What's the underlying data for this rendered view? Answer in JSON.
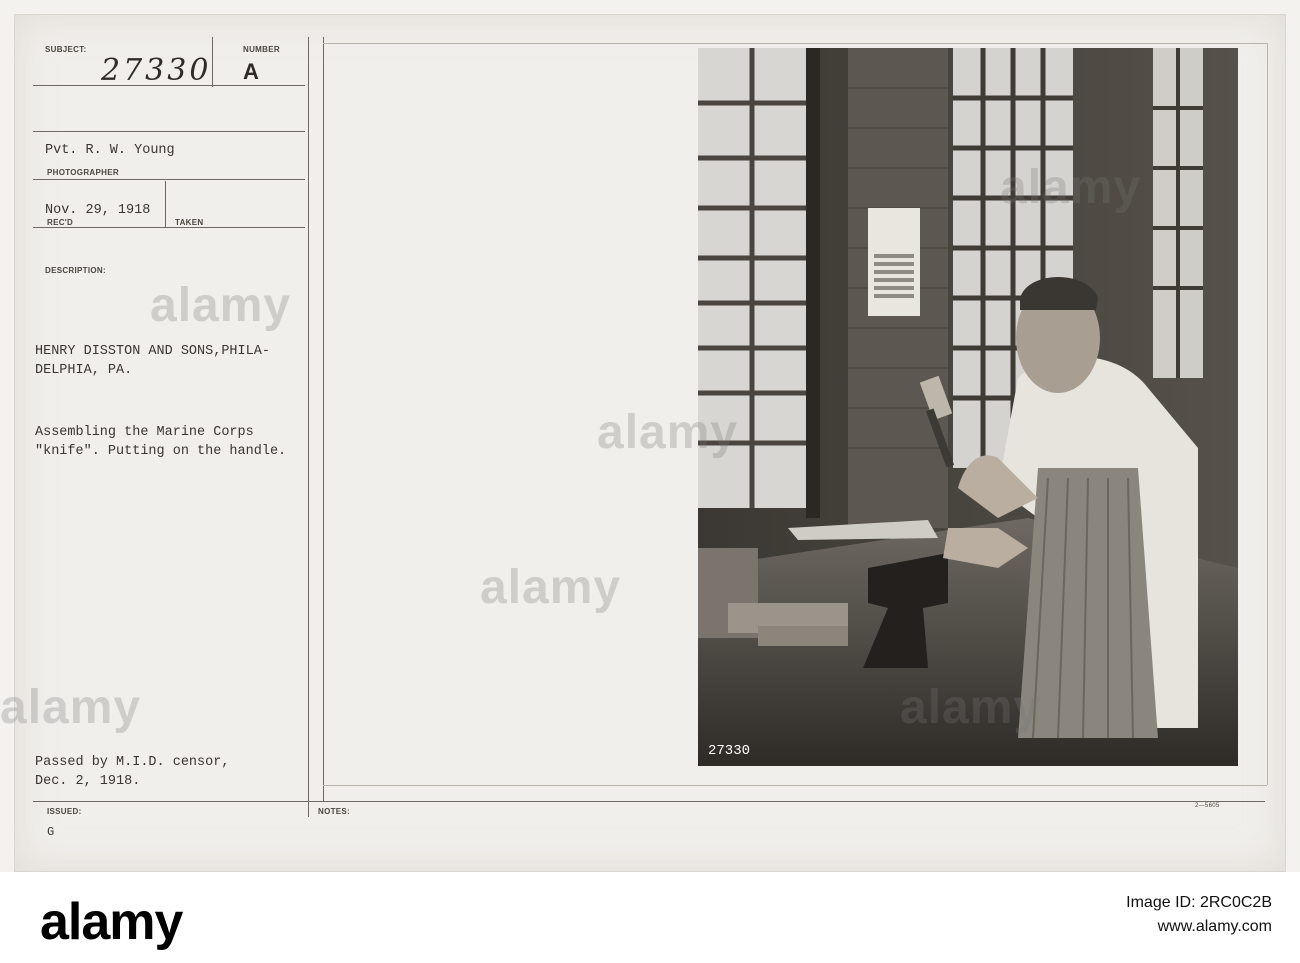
{
  "card": {
    "subject_label": "SUBJECT:",
    "number_label": "NUMBER",
    "subject_value": "27330",
    "number_value": "A",
    "photographer_value": "Pvt. R. W. Young",
    "photographer_label": "PHOTOGRAPHER",
    "received_value": "Nov. 29, 1918",
    "received_label": "REC'D",
    "taken_label": "TAKEN",
    "description_label": "DESCRIPTION:",
    "description_line1": "HENRY DISSTON AND SONS,PHILA-",
    "description_line2": "DELPHIA, PA.",
    "caption_line1": "Assembling the Marine Corps",
    "caption_line2": "\"knife\". Putting on the handle.",
    "censor_line1": "Passed by M.I.D. censor,",
    "censor_line2": "Dec. 2, 1918.",
    "issued_label": "ISSUED:",
    "issued_value": "G",
    "notes_label": "NOTES:",
    "form_code": "2—5605",
    "photo_number": "27330"
  },
  "watermark_text": "alamy",
  "footer": {
    "logo": "alamy",
    "image_id": "Image ID: 2RC0C2B",
    "site": "www.alamy.com"
  }
}
